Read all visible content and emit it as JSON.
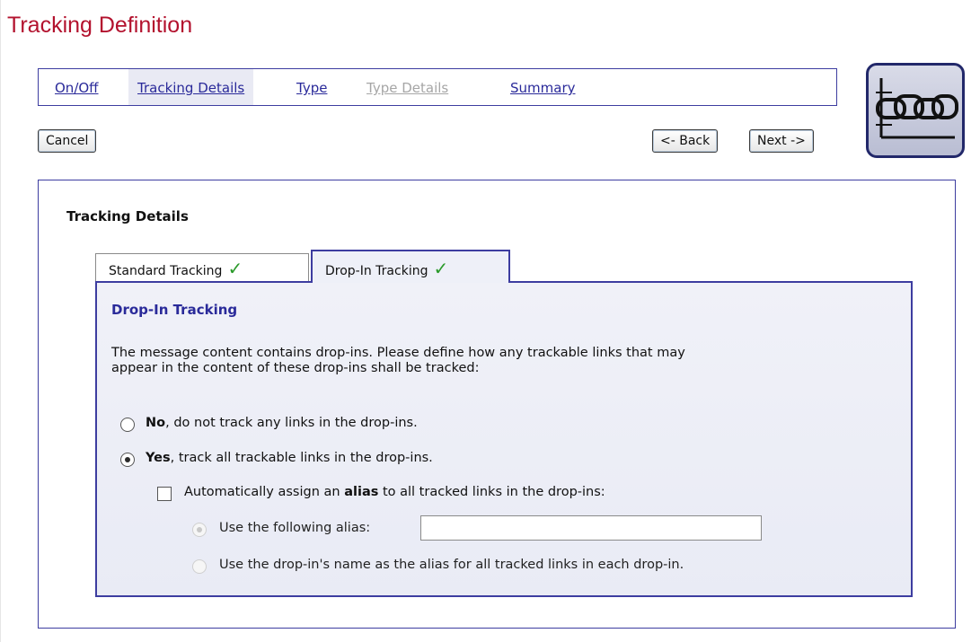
{
  "page": {
    "title": "Tracking Definition"
  },
  "wizard_nav": {
    "items": [
      {
        "label": "On/Off",
        "state": "link"
      },
      {
        "label": "Tracking Details",
        "state": "active"
      },
      {
        "label": "Type",
        "state": "link"
      },
      {
        "label": "Type Details",
        "state": "disabled"
      },
      {
        "label": "Summary",
        "state": "link"
      }
    ]
  },
  "buttons": {
    "cancel": "Cancel",
    "back": "<- Back",
    "next": "Next ->"
  },
  "logo": {
    "icon": "chain-link-icon",
    "colors": {
      "border": "#22286a",
      "fill": "#c8cbdd"
    }
  },
  "section": {
    "title": "Tracking Details"
  },
  "tabs": [
    {
      "label": "Standard Tracking",
      "check": "✓",
      "active": false
    },
    {
      "label": "Drop-In Tracking",
      "check": "✓",
      "active": true
    }
  ],
  "panel": {
    "title": "Drop-In Tracking",
    "description_line1": "The message content contains drop-ins. Please define how any trackable links that may",
    "description_line2": "appear in the content of these drop-ins shall be tracked:",
    "option_no": {
      "bold": "No",
      "rest": ", do not track any links in the drop-ins.",
      "selected": false
    },
    "option_yes": {
      "bold": "Yes",
      "rest": ", track all trackable links in the drop-ins.",
      "selected": true
    },
    "auto_alias": {
      "prefix": "Automatically assign an ",
      "bold": "alias",
      "suffix": " to all tracked links in the drop-ins:",
      "checked": false
    },
    "use_alias": {
      "label": "Use the following alias:",
      "value": "",
      "selected": true,
      "disabled": true
    },
    "use_dropin_name": {
      "label": "Use the drop-in's name as the alias for all tracked links in each drop-in.",
      "selected": false,
      "disabled": true
    }
  },
  "colors": {
    "title": "#b3122e",
    "accent": "#3d3da0",
    "check": "#2a9a2a"
  }
}
